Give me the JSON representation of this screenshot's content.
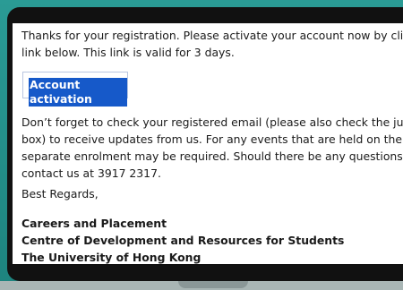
{
  "email": {
    "intro_line1": "Thanks for your registration. Please activate your account now by clicking t",
    "intro_line2": "link below. This link is valid for 3 days.",
    "activation_label": "Account activation",
    "body_line1": "Don’t forget to check your registered email (please also check the junk mai",
    "body_line2": "box) to receive updates from us. For any events that are held on the platfor",
    "body_line3": "separate enrolment may be required. Should there be any questions, pleas",
    "body_line4": "contact us at 3917 2317.",
    "closing": "Best Regards,",
    "signature_line1": "Careers and Placement",
    "signature_line2": "Centre of Development and Resources for Students",
    "signature_line3": "The University of Hong Kong"
  }
}
